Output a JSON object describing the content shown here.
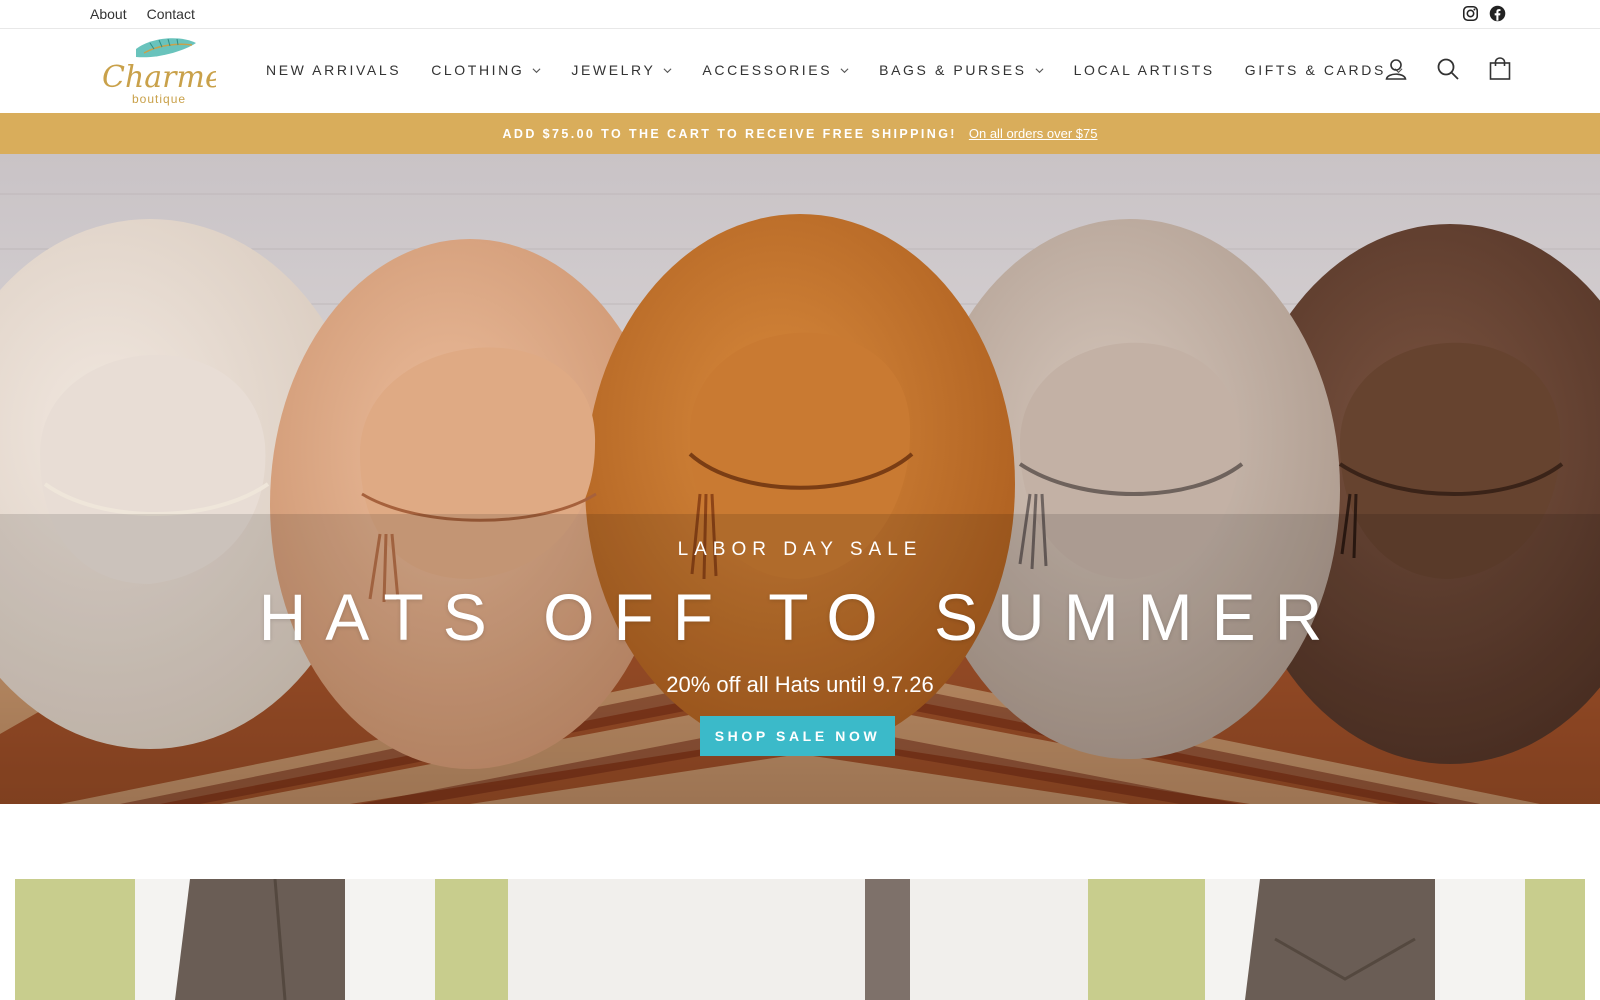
{
  "utility": {
    "links": [
      "About",
      "Contact"
    ],
    "social": [
      "instagram-icon",
      "facebook-icon"
    ]
  },
  "header": {
    "logo_text": "Charmed",
    "logo_subtext": "boutique",
    "nav": [
      {
        "label": "NEW ARRIVALS",
        "dropdown": false
      },
      {
        "label": "CLOTHING",
        "dropdown": true
      },
      {
        "label": "JEWELRY",
        "dropdown": true
      },
      {
        "label": "ACCESSORIES",
        "dropdown": true
      },
      {
        "label": "BAGS & PURSES",
        "dropdown": true
      },
      {
        "label": "LOCAL ARTISTS",
        "dropdown": false
      },
      {
        "label": "GIFTS & CARDS",
        "dropdown": true
      }
    ],
    "icons": [
      "account-icon",
      "search-icon",
      "cart-icon"
    ]
  },
  "announcement": {
    "message": "ADD $75.00 TO THE CART TO RECEIVE FREE SHIPPING!",
    "link": "On all orders over $75"
  },
  "hero": {
    "eyebrow": "LABOR DAY SALE",
    "headline": "HATS OFF TO SUMMER",
    "subline": "20% off all Hats until 9.7.26",
    "cta": "SHOP SALE NOW"
  },
  "colors": {
    "announcement_bg": "#d9ad5b",
    "cta_bg": "#3bbac9",
    "logo_gold": "#c9a14a",
    "logo_teal": "#4fb8b0"
  }
}
